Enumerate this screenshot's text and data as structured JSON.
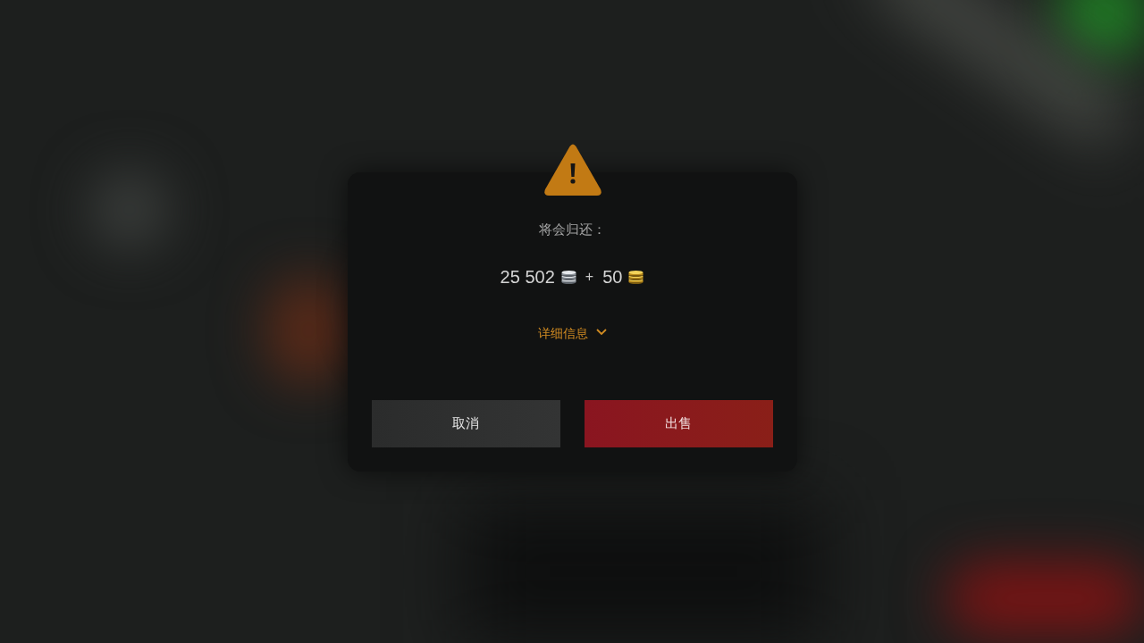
{
  "dialog": {
    "message": "将会归还：",
    "amounts": [
      {
        "value": "25 502",
        "kind": "silver"
      },
      {
        "value": "50",
        "kind": "gold"
      }
    ],
    "separator": "+",
    "details_toggle": {
      "label": "详细信息",
      "expanded": false
    },
    "buttons": [
      {
        "label": "取消",
        "kind": "secondary"
      },
      {
        "label": "出售",
        "kind": "primary"
      }
    ]
  }
}
